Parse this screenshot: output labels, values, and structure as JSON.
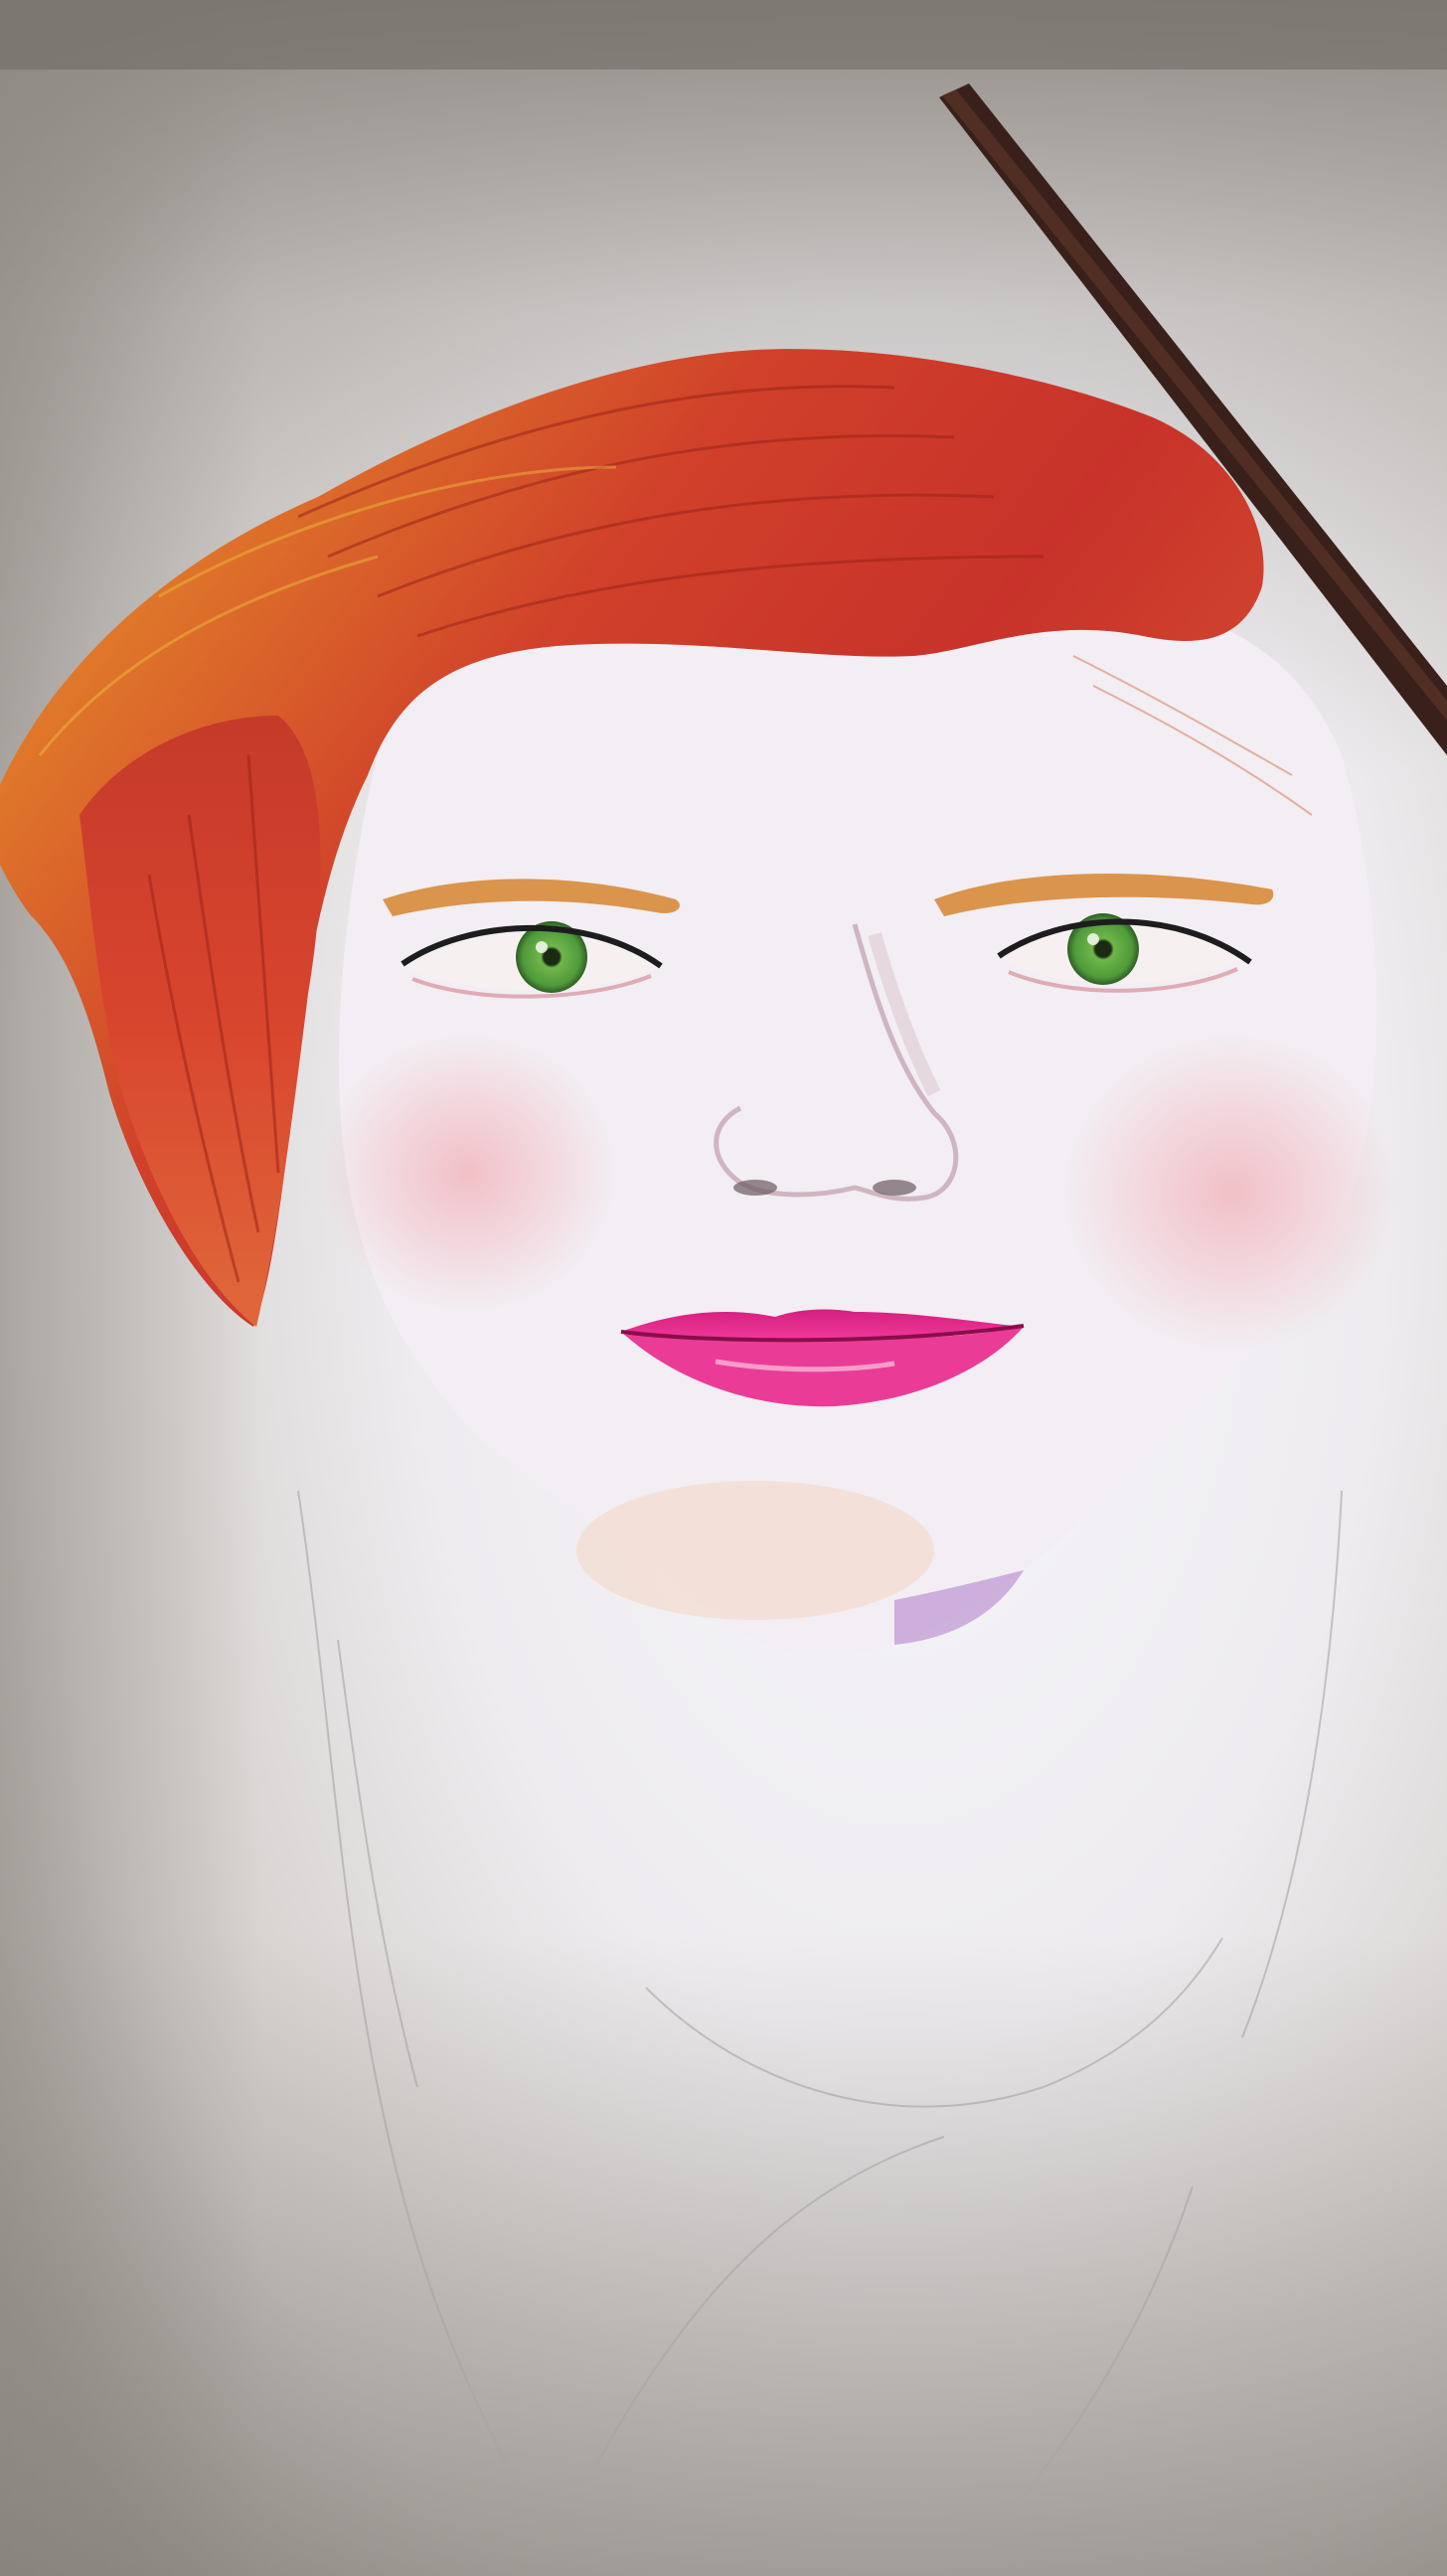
{
  "scene": {
    "subject": "colored-pencil-portrait",
    "colors": {
      "paper_light": "#f4f2f6",
      "paper_shadow": "#8c8781",
      "hair_red": "#c8322a",
      "hair_orange": "#e0702a",
      "hair_yellow": "#e8b830",
      "iris_green": "#4f9a3a",
      "lips_pink": "#e02a8a",
      "cheek_blush": "#f2b6bd",
      "pencil_brown": "#3a201a"
    },
    "icons": [
      "pencil-icon"
    ]
  }
}
